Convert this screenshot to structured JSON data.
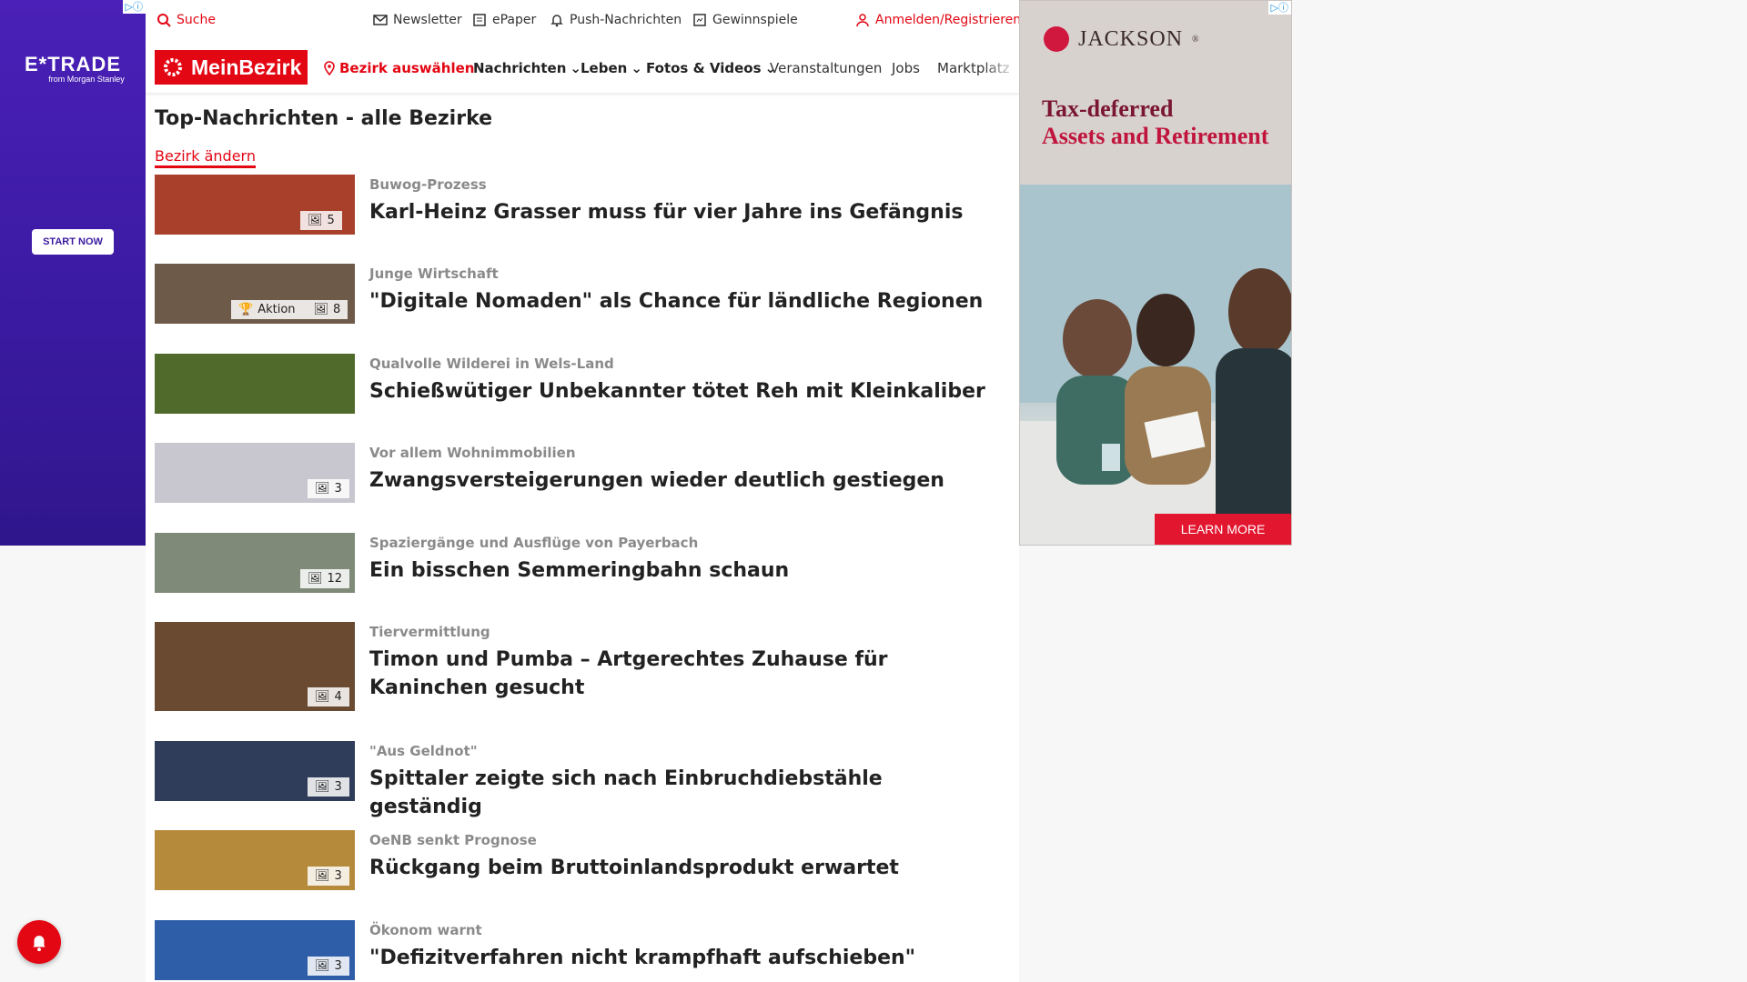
{
  "ads": {
    "left": {
      "brand": "E*TRADE",
      "tagline": "from Morgan Stanley",
      "cta": "START NOW",
      "adchoices": "▷ⓘ"
    },
    "right": {
      "brand": "JACKSON",
      "brand_mark": "®",
      "headline_line1": "Tax-deferred",
      "headline_line2": "Assets and Retirement",
      "cta": "LEARN MORE",
      "adchoices": "▷ⓘ"
    }
  },
  "topbar": {
    "search": "Suche",
    "newsletter": "Newsletter",
    "epaper": "ePaper",
    "push": "Push-Nachrichten",
    "contests": "Gewinnspiele",
    "login": "Anmelden/Registrieren"
  },
  "nav": {
    "logo": "MeinBezirk",
    "select_district": "Bezirk auswählen",
    "items": [
      "Nachrichten",
      "Leben",
      "Fotos & Videos",
      "Veranstaltungen",
      "Jobs",
      "Marktplatz"
    ]
  },
  "page": {
    "title": "Top-Nachrichten - alle Bezirke",
    "change_district": "Bezirk ändern"
  },
  "articles": [
    {
      "kicker": "Buwog-Prozess",
      "headline": "Karl-Heinz Grasser muss für vier Jahre ins Gefängnis",
      "photos": "5",
      "thumb_color": "#a8402c"
    },
    {
      "kicker": "Junge Wirtschaft",
      "headline": "\"Digitale Nomaden\" als Chance für ländliche Regionen",
      "photos": "8",
      "badge_extra": "Aktion",
      "thumb_color": "#6e5a48"
    },
    {
      "kicker": "Qualvolle Wilderei in Wels-Land",
      "headline": "Schießwütiger Unbekannter tötet Reh mit Kleinkaliber",
      "photos": "",
      "thumb_color": "#4f6a2a"
    },
    {
      "kicker": "Vor allem Wohnimmobilien",
      "headline": "Zwangsversteigerungen wieder deutlich gestiegen",
      "photos": "3",
      "thumb_color": "#c8c6cf"
    },
    {
      "kicker": "Spaziergänge und Ausflüge von Payerbach",
      "headline": "Ein bisschen Semmeringbahn schaun",
      "photos": "12",
      "thumb_color": "#7f8a78"
    },
    {
      "kicker": "Tiervermittlung",
      "headline": "Timon und Pumba – Artgerechtes Zuhause für Kaninchen gesucht",
      "photos": "4",
      "thumb_color": "#6a4a30"
    },
    {
      "kicker": "\"Aus Geldnot\"",
      "headline": "Spittaler zeigte sich nach Einbruchdiebstähle geständig",
      "photos": "3",
      "thumb_color": "#2f3d5a"
    },
    {
      "kicker": "OeNB senkt Prognose",
      "headline": "Rückgang beim Bruttoinlandsprodukt erwartet",
      "photos": "3",
      "thumb_color": "#b58a3a"
    },
    {
      "kicker": "Ökonom warnt",
      "headline": "\"Defizitverfahren nicht krampfhaft aufschieben\"",
      "photos": "3",
      "thumb_color": "#2e5ea8"
    }
  ]
}
